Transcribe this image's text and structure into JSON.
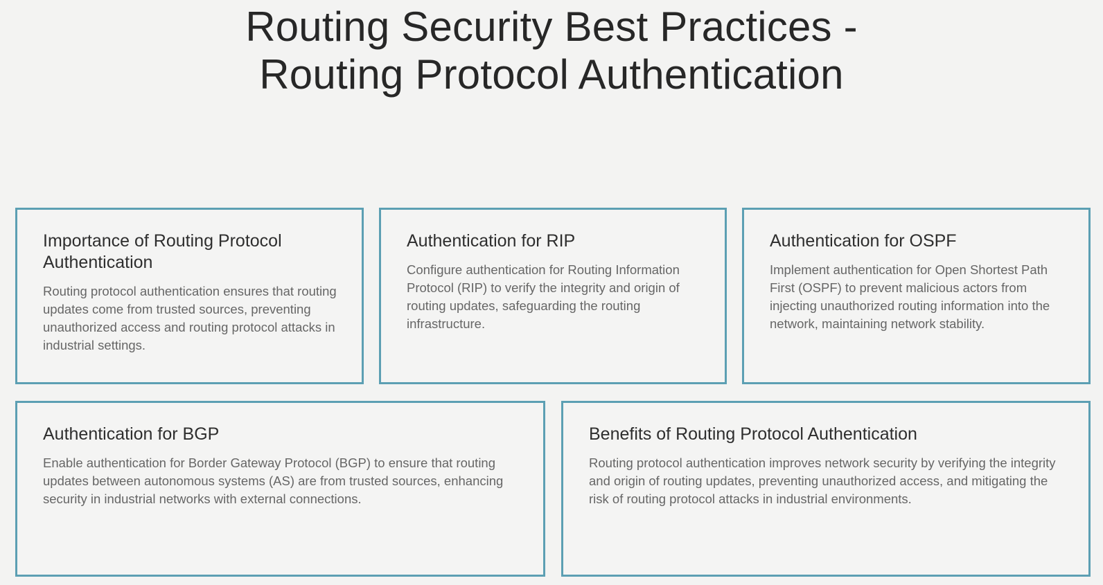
{
  "slide": {
    "title_line1": "Routing Security Best Practices -",
    "title_line2": "Routing Protocol Authentication"
  },
  "cards": [
    {
      "heading": "Importance of Routing Protocol Authentication",
      "body": "Routing protocol authentication ensures that routing updates come from trusted sources, preventing unauthorized access and routing protocol attacks in industrial settings."
    },
    {
      "heading": "Authentication for RIP",
      "body": "Configure authentication for Routing Information Protocol (RIP) to verify the integrity and origin of routing updates, safeguarding the routing infrastructure."
    },
    {
      "heading": "Authentication for OSPF",
      "body": "Implement authentication for Open Shortest Path First (OSPF) to prevent malicious actors from injecting unauthorized routing information into the network, maintaining network stability."
    },
    {
      "heading": "Authentication for BGP",
      "body": "Enable authentication for Border Gateway Protocol (BGP) to ensure that routing updates between autonomous systems (AS) are from trusted sources, enhancing security in industrial networks with external connections."
    },
    {
      "heading": "Benefits of Routing Protocol Authentication",
      "body": "Routing protocol authentication improves network security by verifying the integrity and origin of routing updates, preventing unauthorized access, and mitigating the risk of routing protocol attacks in industrial environments."
    }
  ],
  "colors": {
    "card_border": "#5c9fb3",
    "background": "#f3f3f2"
  }
}
